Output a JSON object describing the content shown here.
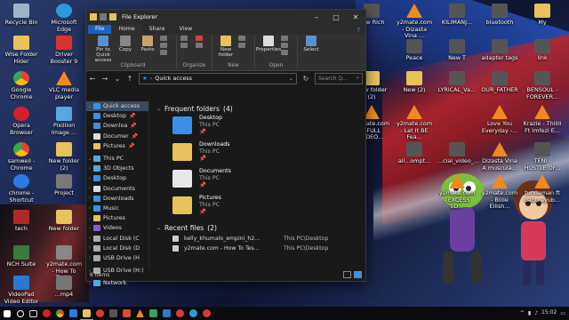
{
  "window": {
    "title": "File Explorer",
    "tabs": [
      "File",
      "Home",
      "Share",
      "View"
    ],
    "ribbon": {
      "clipboard": {
        "pin": "Pin to Quick access",
        "copy": "Copy",
        "paste": "Paste",
        "label": "Clipboard"
      },
      "organize": {
        "label": "Organize"
      },
      "new": {
        "folder": "New folder",
        "label": "New"
      },
      "open": {
        "properties": "Properties",
        "label": "Open"
      },
      "select": {
        "label": "Select"
      }
    },
    "address": "Quick access",
    "search_placeholder": "Search Q...",
    "nav": {
      "quick_access": "Quick access",
      "quick": [
        {
          "label": "Desktop"
        },
        {
          "label": "Downloa"
        },
        {
          "label": "Documer"
        },
        {
          "label": "Pictures"
        }
      ],
      "this_pc": "This PC",
      "pc": [
        {
          "label": "3D Objects"
        },
        {
          "label": "Desktop"
        },
        {
          "label": "Documents"
        },
        {
          "label": "Downloads"
        },
        {
          "label": "Music"
        },
        {
          "label": "Pictures"
        },
        {
          "label": "Videos"
        },
        {
          "label": "Local Disk (C"
        },
        {
          "label": "Local Disk (D"
        },
        {
          "label": "USB Drive (H"
        }
      ],
      "usb": "USB Drive (H:)",
      "network": "Network"
    },
    "frequent_title": "Frequent folders",
    "frequent_count": "(4)",
    "frequent": [
      {
        "name": "Desktop",
        "loc": "This PC",
        "color": "#3b8fe8"
      },
      {
        "name": "Downloads",
        "loc": "This PC",
        "color": "#3b8fe8"
      },
      {
        "name": "Documents",
        "loc": "This PC",
        "color": "#e8e8e8"
      },
      {
        "name": "Pictures",
        "loc": "This PC",
        "color": "#e8c25a"
      }
    ],
    "recent_title": "Recent files",
    "recent_count": "(2)",
    "recent": [
      {
        "name": "kelly_khumalo_empini_h2...",
        "path": "This PC\\Desktop"
      },
      {
        "name": "y2mate.com - How To Tes...",
        "path": "This PC\\Desktop"
      }
    ],
    "status": "6 items"
  },
  "desktop_icons": [
    {
      "label": "Recycle Bin",
      "color": "#9fb3c8"
    },
    {
      "label": "Microsoft Edge",
      "color": "#2d9bd8"
    },
    {
      "label": "Wise Folder Hider",
      "color": "#e8c25a"
    },
    {
      "label": "Driver Booster 9",
      "color": "#d9342b"
    },
    {
      "label": "Google Chrome",
      "color": "#e94235"
    },
    {
      "label": "VLC media player",
      "color": "#f08a1c"
    },
    {
      "label": "Opera Browser",
      "color": "#d6202b"
    },
    {
      "label": "Pixillion Image ...",
      "color": "#5aa7e0"
    },
    {
      "label": "samweli - Chrome",
      "color": "#e94235"
    },
    {
      "label": "New folder (2)",
      "color": "#e8c25a"
    },
    {
      "label": "chrome - Shortcut",
      "color": "#2d7be0"
    },
    {
      "label": "Project",
      "color": "#7a7a7a"
    },
    {
      "label": "tech",
      "color": "#b02a2a"
    },
    {
      "label": "New folder",
      "color": "#e8c25a"
    },
    {
      "label": "NCH Suite",
      "color": "#3a7a3a"
    },
    {
      "label": "y2mate.com - How To Test...",
      "color": "#888"
    },
    {
      "label": "VideoPad Video Editor",
      "color": "#2a7ad0"
    },
    {
      "label": "...mp4",
      "color": "#777"
    },
    {
      "label": "new Rich",
      "color": "#555"
    },
    {
      "label": "y2mate.com - Dizasta Vina ...",
      "color": "#f08a1c"
    },
    {
      "label": "KILIMANJ...",
      "color": "#555"
    },
    {
      "label": "bluetooth",
      "color": "#555"
    },
    {
      "label": "My",
      "color": "#e8c25a"
    },
    {
      "label": "Peace",
      "color": "#555"
    },
    {
      "label": "New T",
      "color": "#555"
    },
    {
      "label": "adapter tags",
      "color": "#555"
    },
    {
      "label": "link",
      "color": "#555"
    },
    {
      "label": "New folder (2)",
      "color": "#e8c25a"
    },
    {
      "label": "New (2)",
      "color": "#e8c25a"
    },
    {
      "label": "LYRICAL_Va...",
      "color": "#555"
    },
    {
      "label": "OUR_FATHER",
      "color": "#555"
    },
    {
      "label": "BENSOUL - FOREVER...",
      "color": "#555"
    },
    {
      "label": "y2mate.com - FULL VIDEO...",
      "color": "#f08a1c"
    },
    {
      "label": "y2mate.com - Let It BE Fea...",
      "color": "#f08a1c"
    },
    {
      "label": "Love You Everyday -...",
      "color": "#f08a1c"
    },
    {
      "label": "Krazie - Thilili Ft Imfezi E...",
      "color": "#f08a1c"
    },
    {
      "label": "all...ompt...",
      "color": "#555"
    },
    {
      "label": "...cial_video_...",
      "color": "#555"
    },
    {
      "label": "Dizasta Vina A muscula...",
      "color": "#f08a1c"
    },
    {
      "label": "TENI - HUSTLE OF...",
      "color": "#555"
    },
    {
      "label": "y2mate.com - EXCESS LO...",
      "color": "#f08a1c"
    },
    {
      "label": "y2mate.com - Billie Eilish...",
      "color": "#f08a1c"
    },
    {
      "label": "tundaman ft babu ayub...",
      "color": "#f08a1c"
    }
  ],
  "taskbar": {
    "time": "15:02",
    "date": "...",
    "lang": "ENG"
  }
}
